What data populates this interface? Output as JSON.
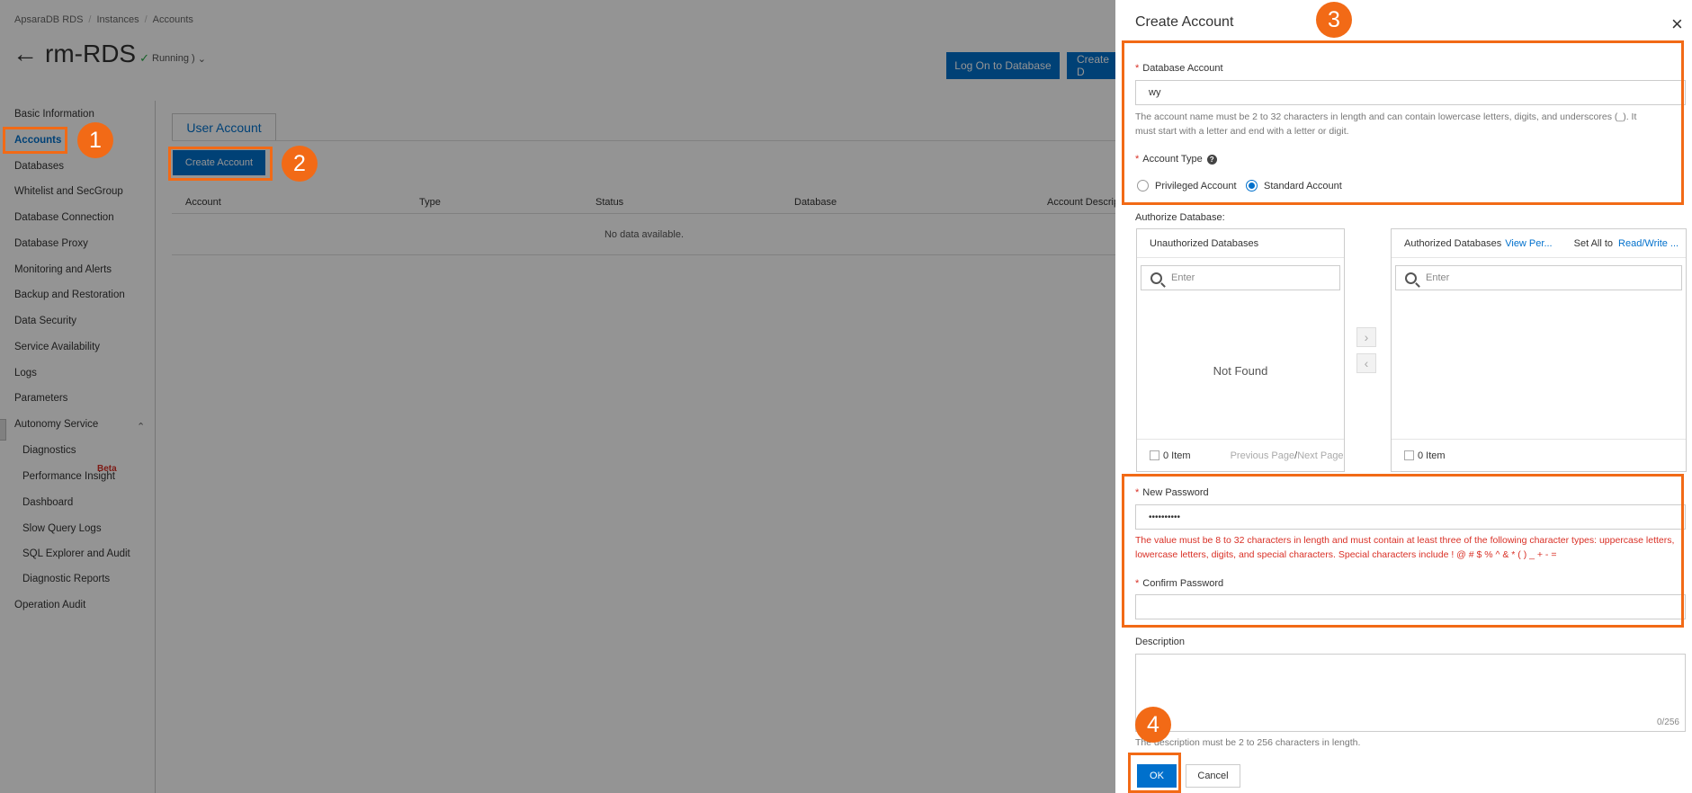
{
  "breadcrumb": [
    "ApsaraDB RDS",
    "Instances",
    "Accounts"
  ],
  "breadcrumb_separator": "/",
  "instance": {
    "name": "rm-RDS",
    "status": "Running )"
  },
  "top_buttons": [
    "Log On to Database",
    "Create D"
  ],
  "sidebar": {
    "items": [
      "Basic Information",
      "Accounts",
      "Databases",
      "Whitelist and SecGroup",
      "Database Connection",
      "Database Proxy",
      "Monitoring and Alerts",
      "Backup and Restoration",
      "Data Security",
      "Service Availability",
      "Logs",
      "Parameters",
      "Autonomy Service",
      "Diagnostics",
      "Performance Insight",
      "Dashboard",
      "Slow Query Logs",
      "SQL Explorer and Audit",
      "Diagnostic Reports",
      "Operation Audit"
    ],
    "active_index": 1,
    "beta_badge": "Beta"
  },
  "main": {
    "tab": "User Account",
    "create_button": "Create Account",
    "columns": [
      "Account",
      "Type",
      "Status",
      "Database",
      "Account Descrip"
    ],
    "empty_text": "No data available."
  },
  "markers": [
    "1",
    "2",
    "3",
    "4"
  ],
  "drawer": {
    "title": "Create Account",
    "required_mark": "*",
    "db_account": {
      "label": "Database Account",
      "value": "wy",
      "hint": "The account name must be 2 to 32 characters in length and can contain lowercase letters, digits, and underscores (_). It must start with a letter and end with a letter or digit."
    },
    "account_type": {
      "label": "Account Type",
      "help_icon": "?",
      "options": [
        "Privileged Account",
        "Standard Account"
      ],
      "selected": "Standard Account"
    },
    "authorize": {
      "label": "Authorize Database:",
      "left": {
        "title": "Unauthorized Databases",
        "search_placeholder": "Enter",
        "empty": "Not Found",
        "count": "0 Item",
        "paging_prev": "Previous Page",
        "paging_sep": "/",
        "paging_next": "Next Page"
      },
      "right": {
        "title": "Authorized Databases",
        "view_link": "View Per...",
        "set_all": "Set All to",
        "set_all_link": "Read/Write ...",
        "search_placeholder": "Enter",
        "count": "0 Item"
      },
      "move_right": "›",
      "move_left": "‹"
    },
    "new_password": {
      "label": "New Password",
      "value": "••••••••••",
      "error_line1": "The value must be 8 to 32 characters in length and must contain at least three of the following character types: uppercase letters,",
      "error_line2": "lowercase letters, digits, and special characters. Special characters include ! @ # $ % ^ & * ( ) _ + - ="
    },
    "confirm_password": {
      "label": "Confirm Password",
      "value": ""
    },
    "description": {
      "label": "Description",
      "counter": "0/256",
      "hint": "The description must be 2 to 256 characters in length."
    },
    "ok_button": "OK",
    "cancel_button": "Cancel",
    "close_icon": "×"
  },
  "colors": {
    "primary": "#0070cc",
    "annotation": "#f26a16",
    "error": "#d93026",
    "success": "#28a745"
  }
}
